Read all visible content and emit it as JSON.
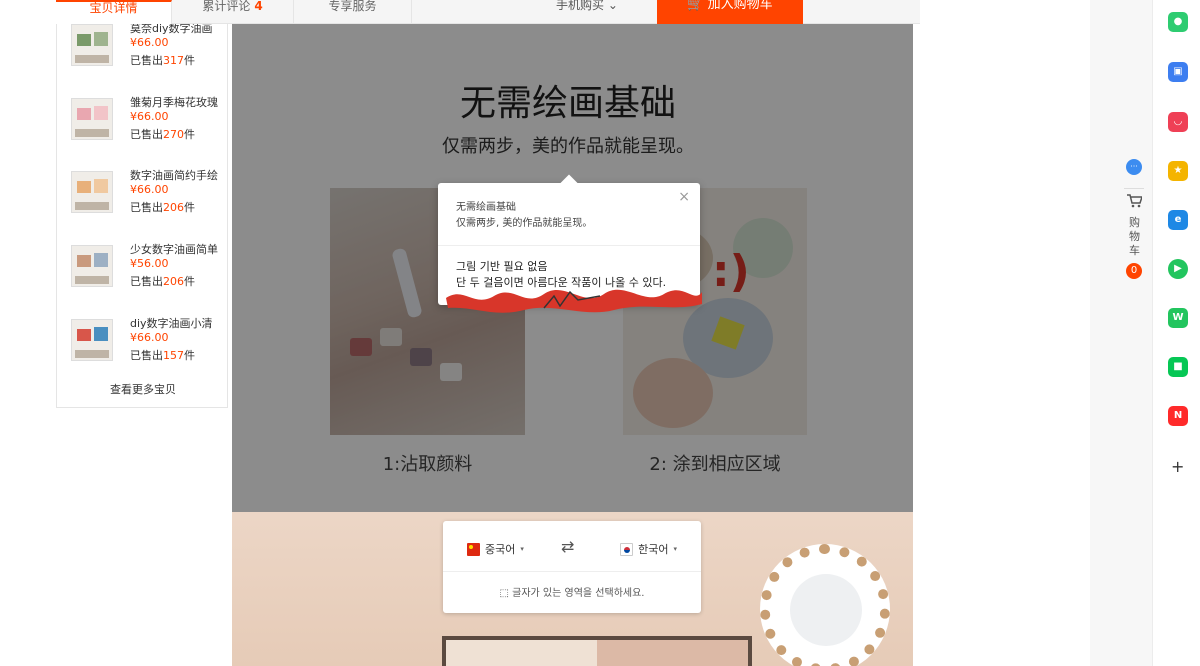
{
  "tabs": {
    "detail": "宝贝详情",
    "reviews": "累计评论",
    "reviews_count": "4",
    "service": "专享服务",
    "mobile_buy": "手机购买",
    "mobile_caret": "⌄",
    "add_to_cart": "加入购物车",
    "cart_glyph": "🛒"
  },
  "products": [
    {
      "name": "莫奈diy数字油画",
      "price": "¥66.00",
      "sold_prefix": "已售出",
      "sold_count": "317",
      "sold_suffix": "件"
    },
    {
      "name": "雏菊月季梅花玫瑰",
      "price": "¥66.00",
      "sold_prefix": "已售出",
      "sold_count": "270",
      "sold_suffix": "件"
    },
    {
      "name": "数字油画简约手绘",
      "price": "¥66.00",
      "sold_prefix": "已售出",
      "sold_count": "206",
      "sold_suffix": "件"
    },
    {
      "name": "少女数字油画简单",
      "price": "¥56.00",
      "sold_prefix": "已售出",
      "sold_count": "206",
      "sold_suffix": "件"
    },
    {
      "name": "diy数字油画小清",
      "price": "¥66.00",
      "sold_prefix": "已售出",
      "sold_count": "157",
      "sold_suffix": "件"
    }
  ],
  "see_more": "查看更多宝贝",
  "detail": {
    "title_main": "无需绘画基础",
    "title_sub": "仅需两步，美的作品就能呈现。",
    "caption1": "1:沾取颜料",
    "caption2": "2: 涂到相应区域",
    "smile": ":)"
  },
  "popup": {
    "close": "×",
    "src_line1": "无需绘画基础",
    "src_line2": "仅需两步, 美的作品就能呈现。",
    "dst_line1": "그림 기반 필요 없음",
    "dst_line2": "단 두 걸음이면 아름다운 작품이 나올 수 있다."
  },
  "langbar": {
    "src_lang": "중국어",
    "dst_lang": "한국어",
    "caret": "▾",
    "swap": "⇄",
    "hint": "글자가 있는 영역을 선택하세요.",
    "select_glyph": "⬚"
  },
  "cart_rail": {
    "bubble": "···",
    "label": "购物车",
    "count": "0"
  },
  "toolbar": {
    "add": "+",
    "icons": [
      {
        "name": "chat-icon",
        "color": "#2ecc71",
        "glyph": "●"
      },
      {
        "name": "toolbox-icon",
        "color": "#3d7ef0",
        "glyph": "▣"
      },
      {
        "name": "pocket-icon",
        "color": "#ef4056",
        "glyph": "◡"
      },
      {
        "name": "star-icon",
        "color": "#f4b400",
        "glyph": "★"
      },
      {
        "name": "edge-icon",
        "color": "#1e88e5",
        "glyph": "e"
      },
      {
        "name": "play-icon",
        "color": "#22c55e",
        "glyph": "▶"
      },
      {
        "name": "webtoon-icon",
        "color": "#22c55e",
        "glyph": "W"
      },
      {
        "name": "line-icon",
        "color": "#06c755",
        "glyph": "■"
      },
      {
        "name": "now-icon",
        "color": "#ff2a2a",
        "glyph": "N"
      }
    ]
  }
}
